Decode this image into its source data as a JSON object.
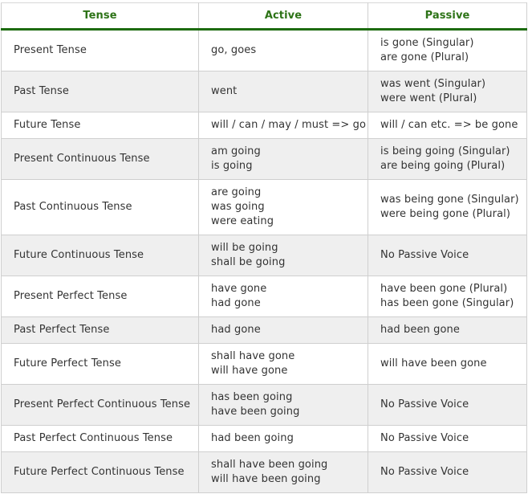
{
  "table": {
    "headers": [
      "Tense",
      "Active",
      "Passive"
    ],
    "rows": [
      {
        "tense": "Present Tense",
        "active": [
          "go, goes"
        ],
        "passive": [
          "is gone (Singular)",
          "are gone (Plural)"
        ]
      },
      {
        "tense": "Past Tense",
        "active": [
          "went"
        ],
        "passive": [
          "was went (Singular)",
          "were went (Plural)"
        ]
      },
      {
        "tense": "Future Tense",
        "active": [
          "will / can / may / must => go"
        ],
        "passive": [
          "will / can etc. => be gone"
        ]
      },
      {
        "tense": "Present Continuous Tense",
        "active": [
          "am going",
          "is going"
        ],
        "passive": [
          "is being going (Singular)",
          "are being going (Plural)"
        ]
      },
      {
        "tense": "Past Continuous Tense",
        "active": [
          "are going",
          "was going",
          "were eating"
        ],
        "passive": [
          "was being gone (Singular)",
          "were being gone (Plural)"
        ]
      },
      {
        "tense": "Future Continuous Tense",
        "active": [
          "will be going",
          "shall be going"
        ],
        "passive": [
          "No Passive Voice"
        ]
      },
      {
        "tense": "Present Perfect Tense",
        "active": [
          "have gone",
          "had gone"
        ],
        "passive": [
          "have been gone (Plural)",
          "has been gone (Singular)"
        ]
      },
      {
        "tense": "Past Perfect Tense",
        "active": [
          "had gone"
        ],
        "passive": [
          "had been gone"
        ]
      },
      {
        "tense": "Future Perfect Tense",
        "active": [
          "shall have gone",
          "will have gone"
        ],
        "passive": [
          "will have been gone"
        ]
      },
      {
        "tense": "Present Perfect Continuous Tense",
        "active": [
          "has been going",
          "have been going"
        ],
        "passive": [
          "No Passive Voice"
        ]
      },
      {
        "tense": "Past Perfect Continuous Tense",
        "active": [
          "had been going"
        ],
        "passive": [
          "No Passive Voice"
        ]
      },
      {
        "tense": "Future Perfect Continuous Tense",
        "active": [
          "shall have been going",
          "will have been going"
        ],
        "passive": [
          "No Passive Voice"
        ]
      }
    ]
  },
  "colors": {
    "header_text": "#2d7317",
    "header_rule": "#1d6b10",
    "row_stripe": "#efefef",
    "border": "#cfcfcf",
    "body_text": "#333333"
  }
}
